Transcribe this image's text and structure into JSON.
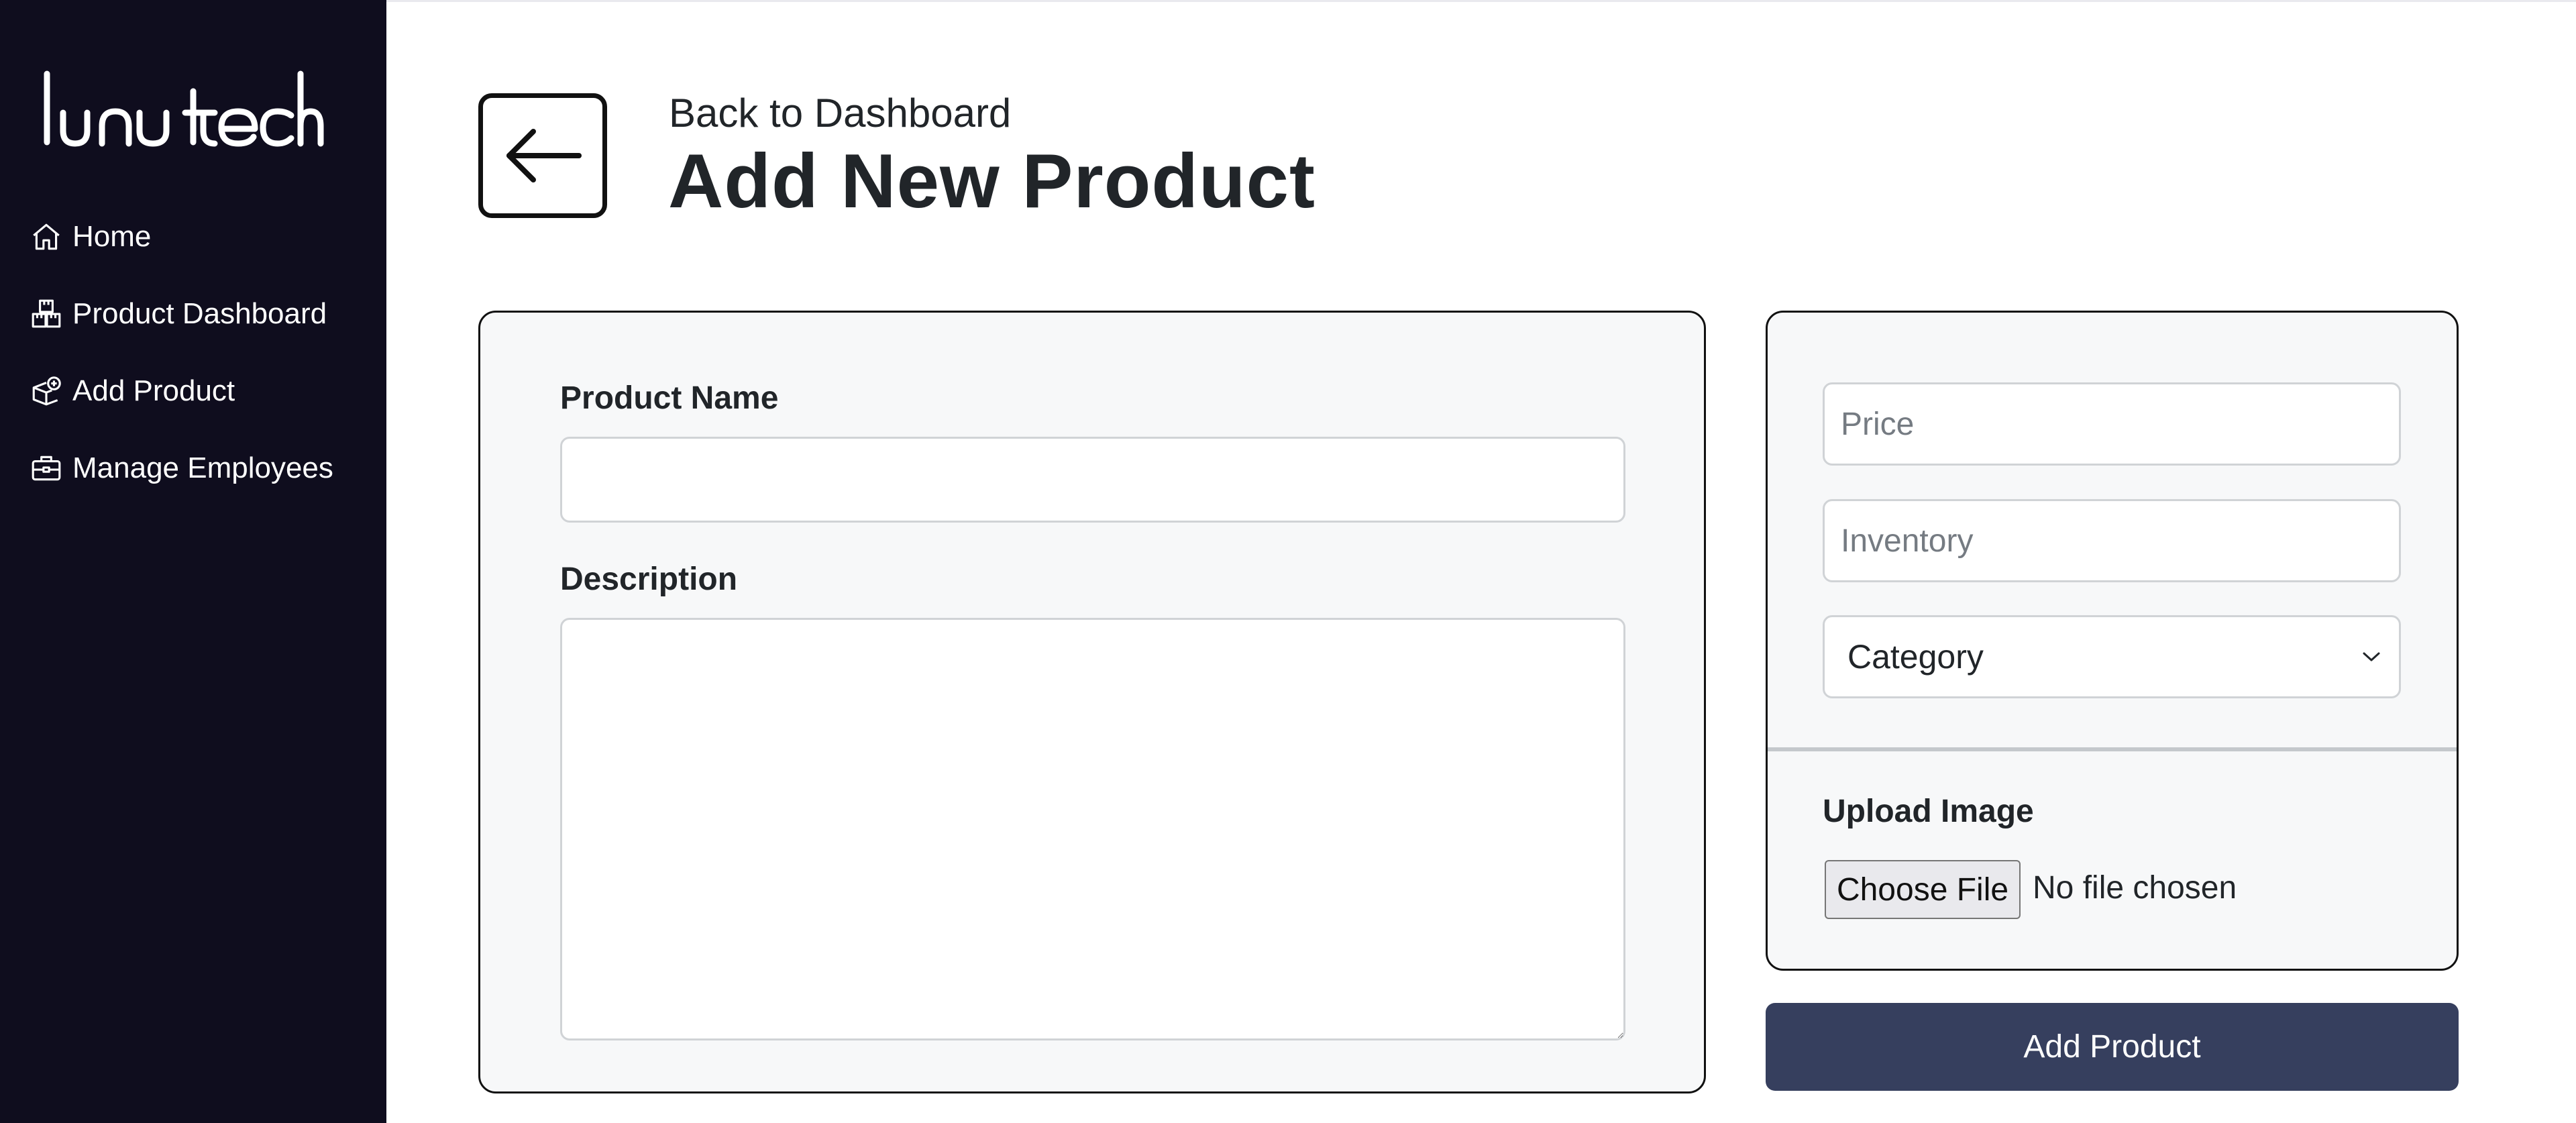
{
  "brand": {
    "logo_text": "lunatech"
  },
  "sidebar": {
    "items": [
      {
        "label": "Home",
        "icon": "home-icon"
      },
      {
        "label": "Product Dashboard",
        "icon": "boxes-icon"
      },
      {
        "label": "Add Product",
        "icon": "box-plus-icon"
      },
      {
        "label": "Manage Employees",
        "icon": "briefcase-icon"
      }
    ]
  },
  "header": {
    "back_label": "Back to Dashboard",
    "title": "Add New Product"
  },
  "form": {
    "product_name": {
      "label": "Product Name",
      "value": "",
      "placeholder": ""
    },
    "description": {
      "label": "Description",
      "value": "",
      "placeholder": ""
    },
    "price": {
      "placeholder": "Price",
      "value": ""
    },
    "inventory": {
      "placeholder": "Inventory",
      "value": ""
    },
    "category": {
      "selected": "Category"
    },
    "upload": {
      "label": "Upload Image",
      "button_label": "Choose File",
      "status": "No file chosen"
    },
    "submit_label": "Add Product"
  },
  "colors": {
    "sidebar_bg": "#0f0d1e",
    "submit_bg": "#363f5e",
    "card_bg": "#f7f8f9"
  }
}
